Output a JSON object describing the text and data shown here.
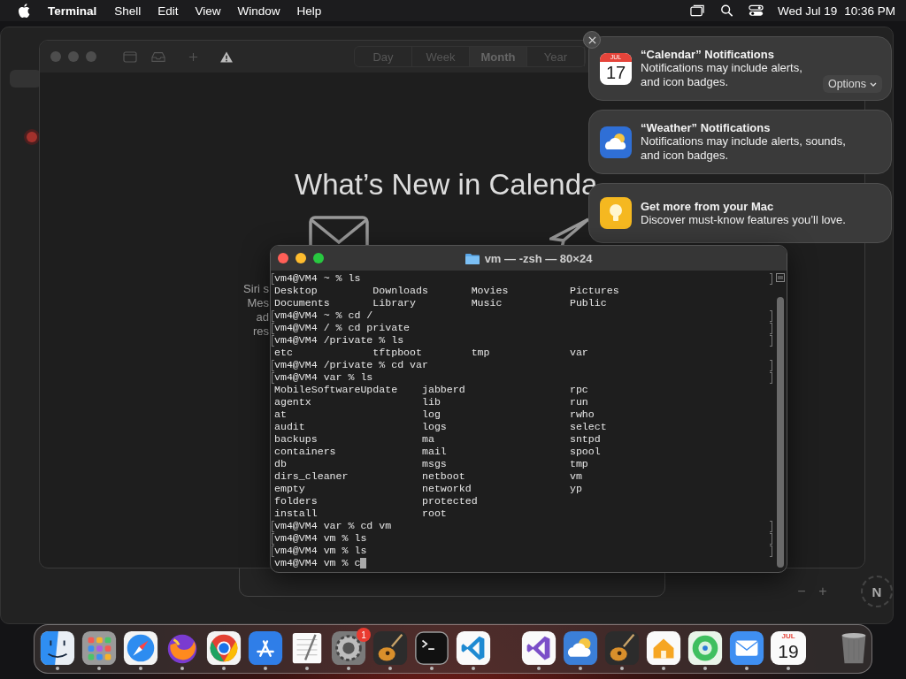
{
  "menu_bar": {
    "app_name": "Terminal",
    "menus": [
      "Shell",
      "Edit",
      "View",
      "Window",
      "Help"
    ],
    "date": "Wed Jul 19",
    "time": "10:36 PM"
  },
  "maps": {
    "zoom_out": "−",
    "zoom_in": "+",
    "compass": "N"
  },
  "calendar": {
    "views": [
      {
        "label": "Day",
        "selected": false
      },
      {
        "label": "Week",
        "selected": false
      },
      {
        "label": "Month",
        "selected": true
      },
      {
        "label": "Year",
        "selected": false
      }
    ],
    "heading": "What’s New in Calenda",
    "feature_fragments": [
      "Siri s",
      "Mes",
      "ad",
      "res"
    ]
  },
  "terminal": {
    "title": "vm — -zsh — 80×24",
    "lines": [
      {
        "text": "vm4@VM4 ~ % ls",
        "marked": true
      },
      {
        "text": "Desktop         Downloads       Movies          Pictures",
        "marked": false
      },
      {
        "text": "Documents       Library         Music           Public",
        "marked": false
      },
      {
        "text": "vm4@VM4 ~ % cd /",
        "marked": true
      },
      {
        "text": "vm4@VM4 / % cd private",
        "marked": true
      },
      {
        "text": "vm4@VM4 /private % ls",
        "marked": true
      },
      {
        "text": "etc             tftpboot        tmp             var",
        "marked": false
      },
      {
        "text": "vm4@VM4 /private % cd var",
        "marked": true
      },
      {
        "text": "vm4@VM4 var % ls",
        "marked": true
      },
      {
        "text": "MobileSoftwareUpdate    jabberd                 rpc",
        "marked": false
      },
      {
        "text": "agentx                  lib                     run",
        "marked": false
      },
      {
        "text": "at                      log                     rwho",
        "marked": false
      },
      {
        "text": "audit                   logs                    select",
        "marked": false
      },
      {
        "text": "backups                 ma                      sntpd",
        "marked": false
      },
      {
        "text": "containers              mail                    spool",
        "marked": false
      },
      {
        "text": "db                      msgs                    tmp",
        "marked": false
      },
      {
        "text": "dirs_cleaner            netboot                 vm",
        "marked": false
      },
      {
        "text": "empty                   networkd                yp",
        "marked": false
      },
      {
        "text": "folders                 protected",
        "marked": false
      },
      {
        "text": "install                 root",
        "marked": false
      },
      {
        "text": "vm4@VM4 var % cd vm",
        "marked": true
      },
      {
        "text": "vm4@VM4 vm % ls",
        "marked": true
      },
      {
        "text": "vm4@VM4 vm % ls",
        "marked": true
      },
      {
        "text": "vm4@VM4 vm % c",
        "marked": false,
        "cursor": true
      }
    ]
  },
  "notifications": [
    {
      "kind": "calendar",
      "icon_month": "JUL",
      "icon_day": "17",
      "title": "“Calendar” Notifications",
      "body": "Notifications may include alerts, and icon badges.",
      "action": "Options"
    },
    {
      "kind": "weather",
      "title": "“Weather” Notifications",
      "body": "Notifications may include alerts, sounds, and icon badges."
    },
    {
      "kind": "tips",
      "title": "Get more from your Mac",
      "body": "Discover must-know features you’ll love."
    }
  ],
  "dock": [
    {
      "kind": "finder",
      "running": true
    },
    {
      "kind": "launchpad",
      "running": true
    },
    {
      "kind": "safari",
      "running": true
    },
    {
      "kind": "firefox",
      "running": true
    },
    {
      "kind": "chrome",
      "running": true
    },
    {
      "kind": "appstore",
      "running": true
    },
    {
      "kind": "textedit",
      "running": true
    },
    {
      "kind": "settings",
      "running": true,
      "badge": "1"
    },
    {
      "kind": "guitar",
      "running": true
    },
    {
      "kind": "terminal",
      "running": true
    },
    {
      "kind": "vscode",
      "running": true
    },
    {
      "kind": "separator"
    },
    {
      "kind": "vs",
      "running": true
    },
    {
      "kind": "weather",
      "running": true
    },
    {
      "kind": "guitar",
      "running": true
    },
    {
      "kind": "home",
      "running": true
    },
    {
      "kind": "findmy",
      "running": true
    },
    {
      "kind": "mail",
      "running": true
    },
    {
      "kind": "calendar",
      "running": true,
      "month": "JUL",
      "day": "19"
    },
    {
      "kind": "separator"
    },
    {
      "kind": "trash",
      "running": false
    }
  ]
}
